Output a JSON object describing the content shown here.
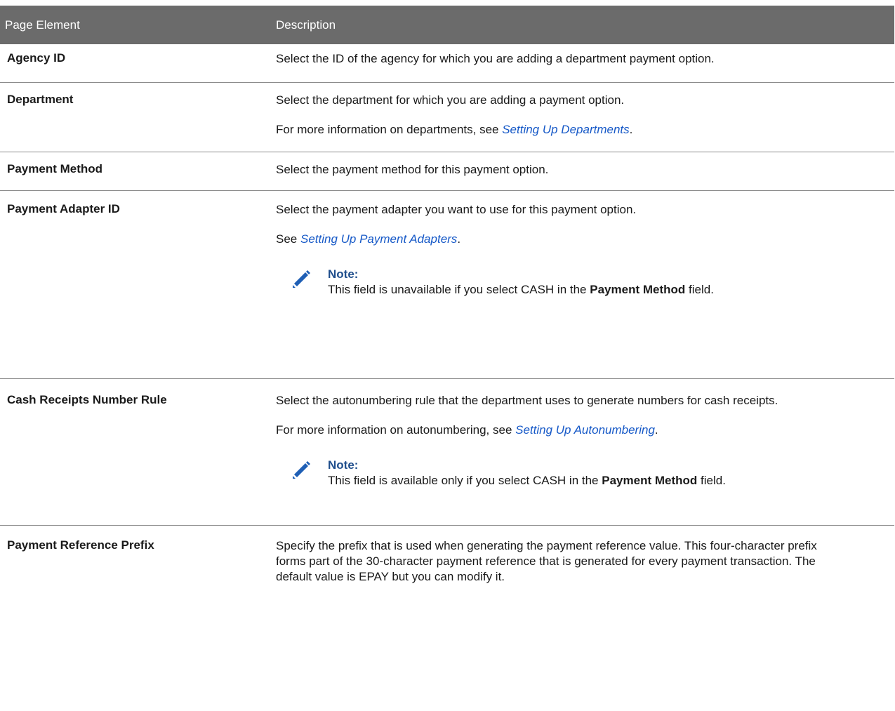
{
  "table": {
    "headers": {
      "col1": "Page Element",
      "col2": "Description"
    },
    "rows": [
      {
        "label": "Agency ID",
        "desc": "Select the ID of the agency for which you are adding a department payment option."
      },
      {
        "label": "Department",
        "desc": "Select the department for which you are adding a payment option.",
        "more_before": "For more information on departments, see ",
        "link": "Setting Up Departments",
        "more_after": "."
      },
      {
        "label": "Payment Method",
        "desc": "Select the payment method for this payment option."
      },
      {
        "label": "Payment Adapter ID",
        "desc": "Select the payment adapter you want to use for this payment option.",
        "more_before": "See ",
        "link": "Setting Up Payment Adapters",
        "more_after": ".",
        "note_title": "Note:",
        "note_before": "This field is unavailable if you select CASH in the ",
        "note_bold": "Payment Method",
        "note_after": " field."
      },
      {
        "label": "Cash Receipts Number Rule",
        "desc": "Select the autonumbering rule that the department uses to generate numbers for cash receipts.",
        "more_before": "For more information on autonumbering, see ",
        "link": "Setting Up Autonumbering",
        "more_after": ".",
        "note_title": "Note:",
        "note_before": "This field is available only if you select CASH in the ",
        "note_bold": "Payment Method",
        "note_after": " field."
      },
      {
        "label": "Payment Reference Prefix",
        "desc": "Specify the prefix that is used when generating the payment reference value. This four-character prefix forms part of the 30-character payment reference that is generated for every payment transaction. The default value is EPAY but you can modify it."
      }
    ]
  }
}
